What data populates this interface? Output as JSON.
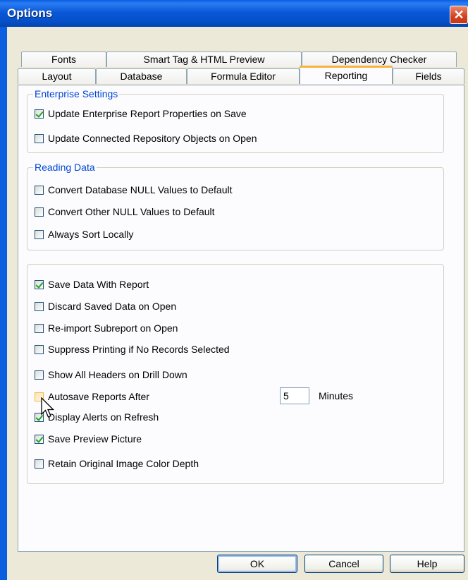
{
  "window": {
    "title": "Options",
    "close_glyph": "✕"
  },
  "tabs_row1": [
    "Fonts",
    "Smart Tag & HTML Preview",
    "Dependency Checker"
  ],
  "tabs_row2": [
    "Layout",
    "Database",
    "Formula Editor",
    "Reporting",
    "Fields"
  ],
  "active_tab": "Reporting",
  "enterprise": {
    "legend": "Enterprise Settings",
    "items": [
      {
        "label": "Update Enterprise Report Properties on Save",
        "checked": true
      },
      {
        "label": "Update Connected Repository Objects on Open",
        "checked": false
      }
    ]
  },
  "reading": {
    "legend": "Reading Data",
    "items": [
      {
        "label": "Convert Database NULL Values to Default",
        "checked": false
      },
      {
        "label": "Convert Other NULL Values to Default",
        "checked": false
      },
      {
        "label": "Always Sort Locally",
        "checked": false
      }
    ]
  },
  "general": {
    "items": [
      {
        "label": "Save Data With Report",
        "checked": true
      },
      {
        "label": "Discard Saved Data on Open",
        "checked": false
      },
      {
        "label": "Re-import Subreport on Open",
        "checked": false
      },
      {
        "label": "Suppress Printing if No Records Selected",
        "checked": false
      },
      {
        "label": "Show All Headers on Drill Down",
        "checked": false
      },
      {
        "label": "Autosave Reports After",
        "checked": false
      },
      {
        "label": "Display Alerts on Refresh",
        "checked": true
      },
      {
        "label": "Save Preview Picture",
        "checked": true
      },
      {
        "label": "Retain Original Image Color Depth",
        "checked": false
      }
    ],
    "autosave_minutes": "5",
    "minutes_label": "Minutes"
  },
  "buttons": {
    "ok": "OK",
    "cancel": "Cancel",
    "help": "Help"
  },
  "colors": {
    "titlebar": "#0a5fe0",
    "legend": "#0046d5",
    "check": "#21a121",
    "active_tab_accent": "#f5b342"
  }
}
